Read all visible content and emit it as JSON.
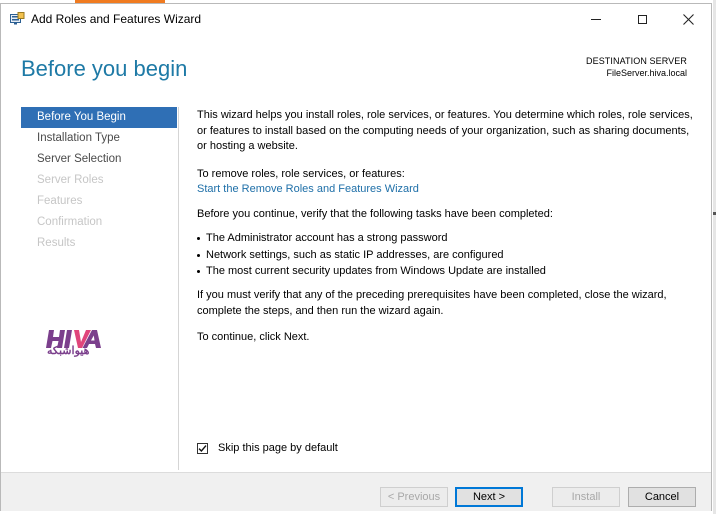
{
  "window": {
    "title": "Add Roles and Features Wizard"
  },
  "header": {
    "page_title": "Before you begin",
    "destination_label": "DESTINATION SERVER",
    "destination_server": "FileServer.hiva.local"
  },
  "nav": {
    "items": [
      {
        "label": "Before You Begin",
        "state": "selected"
      },
      {
        "label": "Installation Type",
        "state": "enabled"
      },
      {
        "label": "Server Selection",
        "state": "enabled"
      },
      {
        "label": "Server Roles",
        "state": "disabled"
      },
      {
        "label": "Features",
        "state": "disabled"
      },
      {
        "label": "Confirmation",
        "state": "disabled"
      },
      {
        "label": "Results",
        "state": "disabled"
      }
    ]
  },
  "watermark": {
    "text": "هیواشبکه"
  },
  "content": {
    "intro": "This wizard helps you install roles, role services, or features. You determine which roles, role services, or features to install based on the computing needs of your organization, such as sharing documents, or hosting a website.",
    "remove_heading": "To remove roles, role services, or features:",
    "remove_link": "Start the Remove Roles and Features Wizard",
    "verify_heading": "Before you continue, verify that the following tasks have been completed:",
    "bullets": [
      "The Administrator account has a strong password",
      "Network settings, such as static IP addresses, are configured",
      "The most current security updates from Windows Update are installed"
    ],
    "prereq_note": "If you must verify that any of the preceding prerequisites have been completed, close the wizard, complete the steps, and then run the wizard again.",
    "continue_note": "To continue, click Next."
  },
  "options": {
    "skip_label": "Skip this page by default",
    "skip_checked": true
  },
  "footer": {
    "previous": "< Previous",
    "next": "Next >",
    "install": "Install",
    "cancel": "Cancel"
  },
  "colors": {
    "accent": "#2f6fb5",
    "title_blue": "#1e7aa6",
    "link": "#1e6fa8",
    "brand_purple": "#7b3f8c"
  }
}
